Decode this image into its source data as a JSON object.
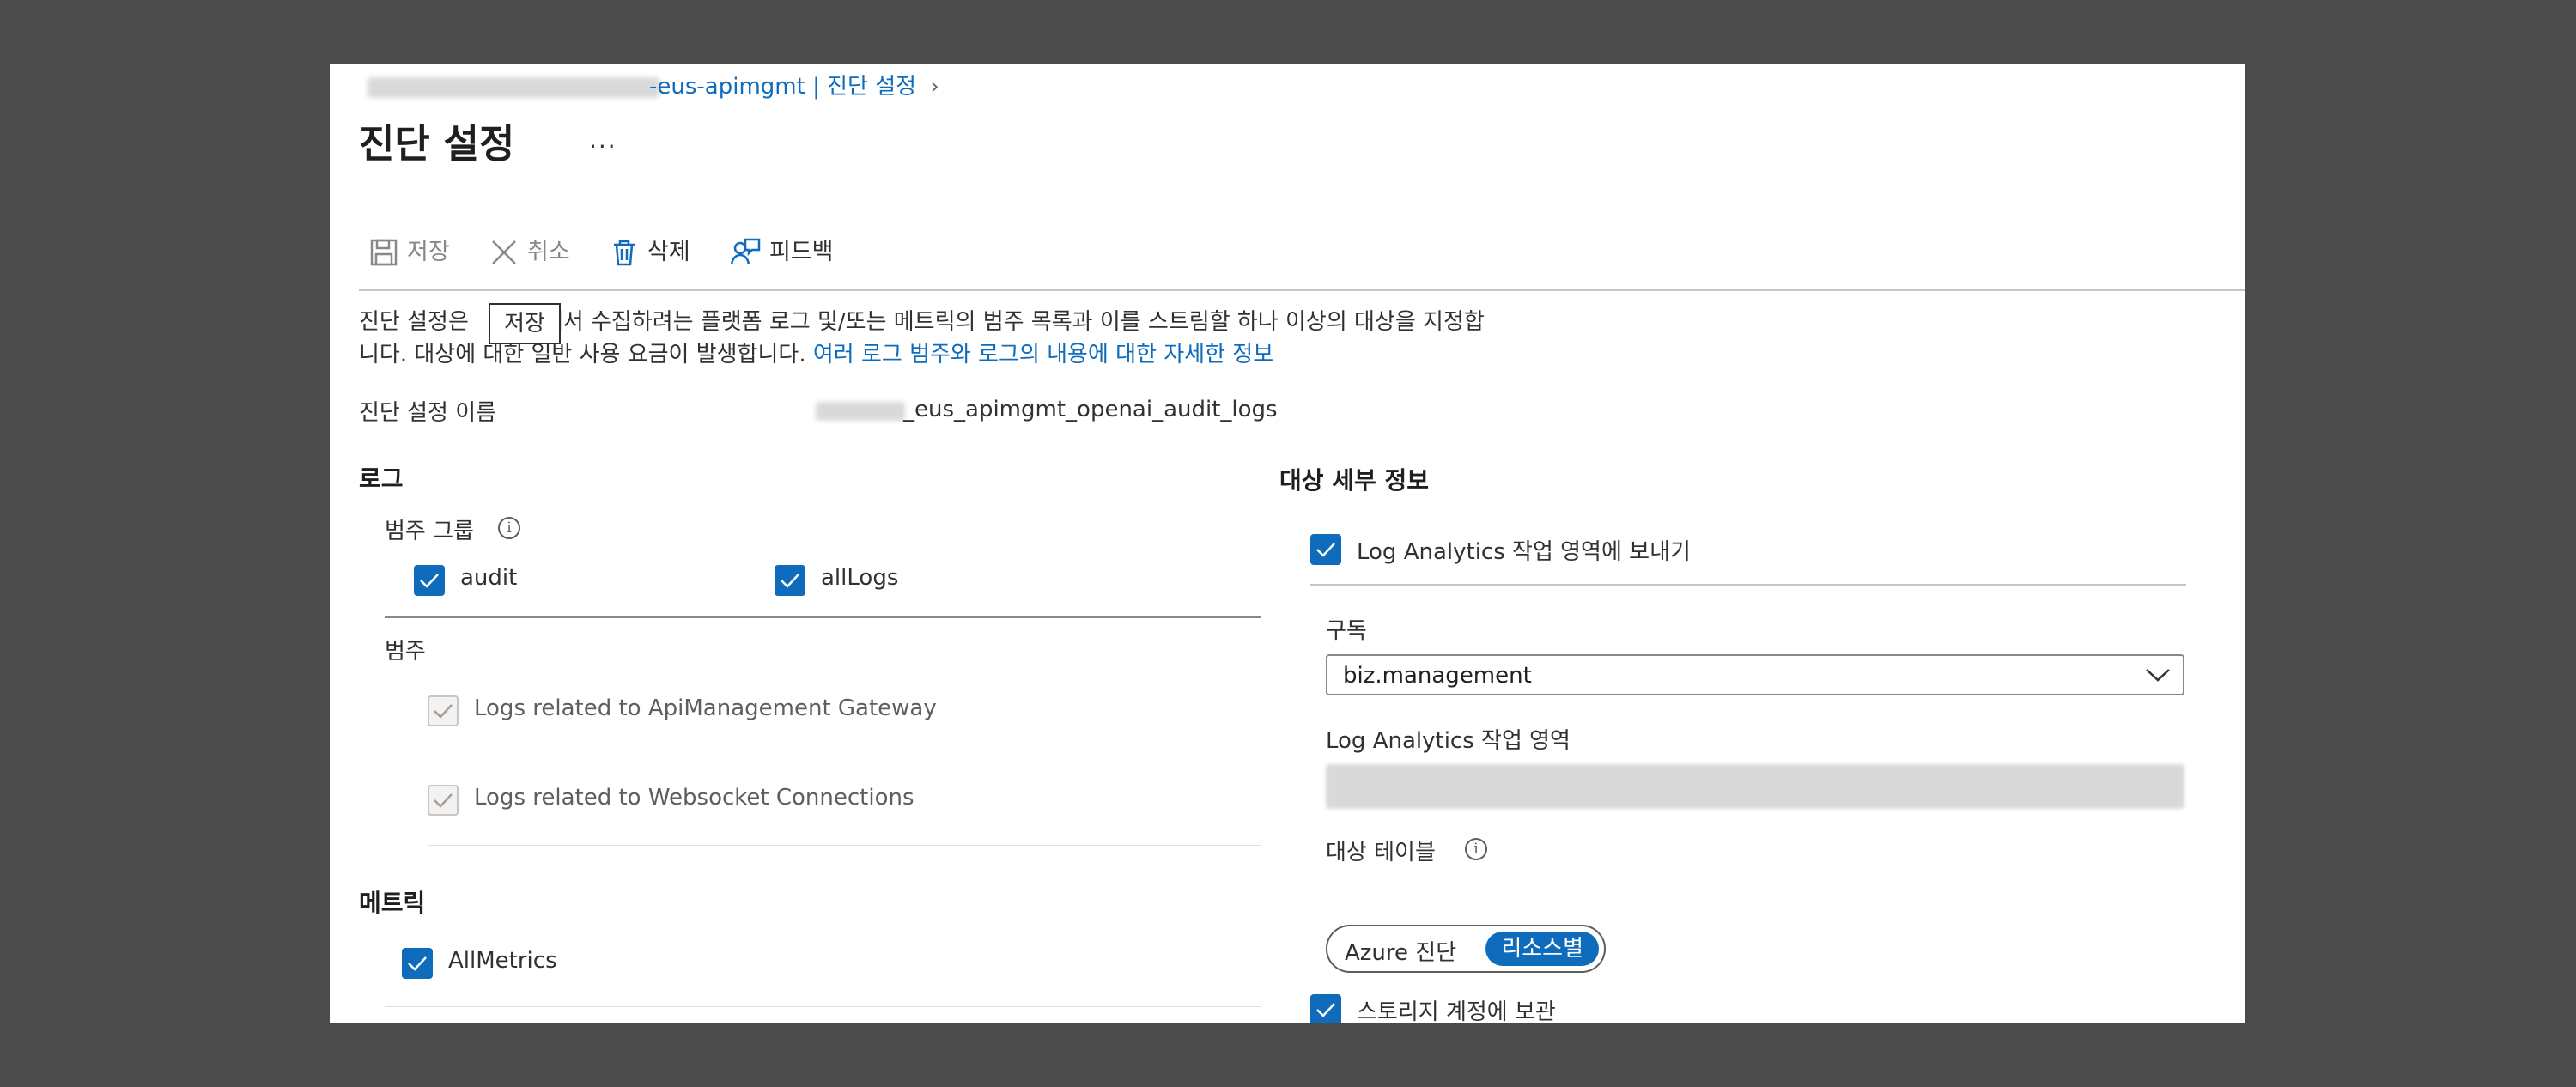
{
  "breadcrumb": {
    "resource": "-eus-apimgmt",
    "separator": "|",
    "current": "진단 설정",
    "chevron": "›"
  },
  "page": {
    "title": "진단 설정",
    "more": "···"
  },
  "toolbar": {
    "save": "저장",
    "cancel": "취소",
    "delete": "삭제",
    "feedback": "피드백"
  },
  "description": {
    "line1_a": "진단 설정은",
    "line1_b": "에서 수집하려는 플랫폼 로그 및/또는 메트릭의 범주 목록과 이를 스트림할 하나 이상의 대상을 지정합",
    "line2": "니다. 대상에 대한 일반 사용 요금이 발생합니다.",
    "link": "여러 로그 범주와 로그의 내용에 대한 자세한 정보",
    "tooltip": "저장"
  },
  "name_field": {
    "label": "진단 설정 이름",
    "value": "_eus_apimgmt_openai_audit_logs"
  },
  "logs": {
    "heading": "로그",
    "category_groups_label": "범주 그룹",
    "category_groups": [
      {
        "label": "audit",
        "checked": true
      },
      {
        "label": "allLogs",
        "checked": true
      }
    ],
    "categories_label": "범주",
    "categories": [
      {
        "label": "Logs related to ApiManagement Gateway",
        "checked": true,
        "disabled": true
      },
      {
        "label": "Logs related to Websocket Connections",
        "checked": true,
        "disabled": true
      }
    ]
  },
  "metrics": {
    "heading": "메트릭",
    "items": [
      {
        "label": "AllMetrics",
        "checked": true
      }
    ]
  },
  "destination": {
    "heading": "대상 세부 정보",
    "send_to_log_analytics": {
      "label": "Log Analytics 작업 영역에 보내기",
      "checked": true
    },
    "subscription_label": "구독",
    "subscription_value": "biz.management",
    "workspace_label": "Log Analytics 작업 영역",
    "table_label": "대상 테이블",
    "table_options": [
      "Azure 진단",
      "리소스별"
    ],
    "table_selected": "리소스별",
    "archive_storage": {
      "label": "스토리지 계정에 보관",
      "checked": true
    }
  },
  "colors": {
    "accent": "#0f6cbd",
    "backdrop": "#4b4b4b"
  }
}
